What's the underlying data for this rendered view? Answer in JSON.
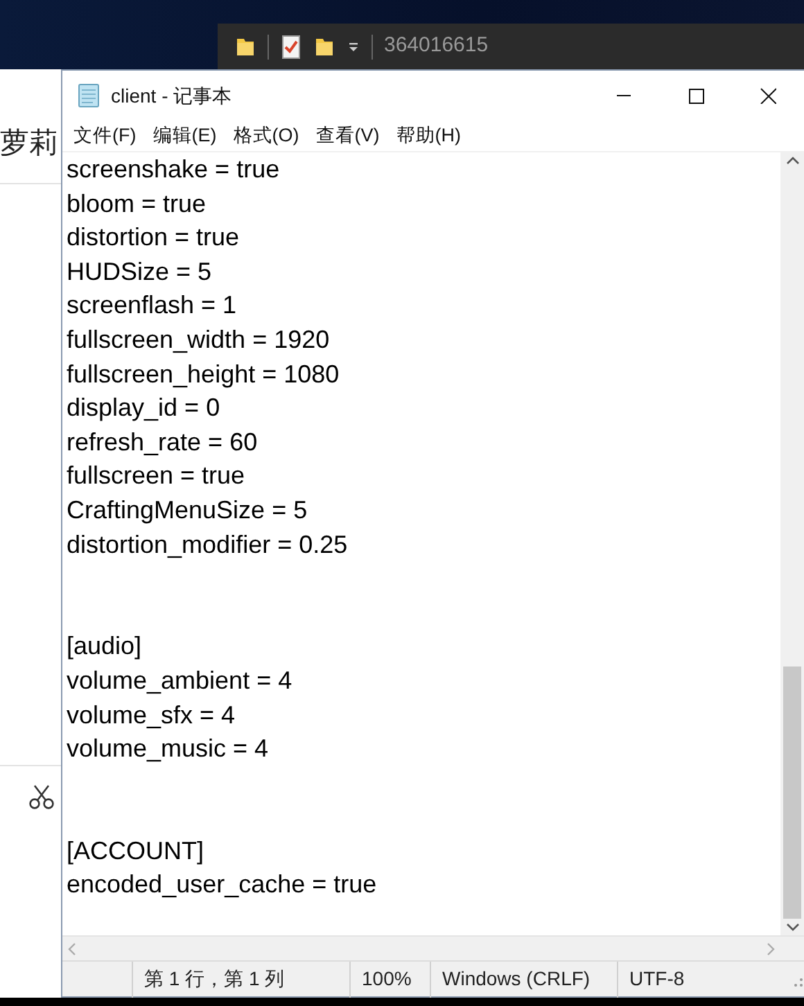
{
  "explorer_bar": {
    "title": "364016615"
  },
  "background_window": {
    "heading": "萝莉"
  },
  "window": {
    "title": "client - 记事本"
  },
  "menu": [
    "文件(F)",
    "编辑(E)",
    "格式(O)",
    "查看(V)",
    "帮助(H)"
  ],
  "text_blocks": [
    [
      "screenshake = true",
      "bloom = true",
      "distortion = true",
      "HUDSize = 5",
      "screenflash = 1",
      "fullscreen_width = 1920",
      "fullscreen_height = 1080",
      "display_id = 0",
      "refresh_rate = 60",
      "fullscreen = true",
      "CraftingMenuSize = 5",
      "distortion_modifier = 0.25"
    ],
    [
      "[audio]",
      "volume_ambient = 4",
      "volume_sfx = 4",
      "volume_music = 4"
    ],
    [
      "[ACCOUNT]",
      "encoded_user_cache = true"
    ]
  ],
  "status_bar": [
    "第 1 行，第 1 列",
    "100%",
    "Windows (CRLF)",
    "UTF-8"
  ]
}
